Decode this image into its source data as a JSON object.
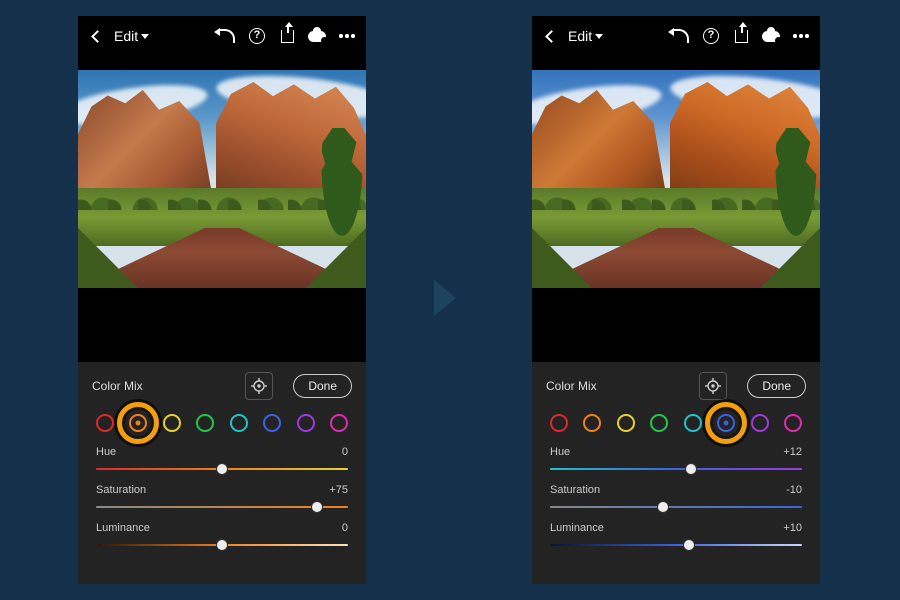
{
  "topbar": {
    "edit_label": "Edit"
  },
  "panel": {
    "title": "Color Mix",
    "done": "Done",
    "labels": {
      "hue": "Hue",
      "sat": "Saturation",
      "lum": "Luminance"
    }
  },
  "swatches": [
    {
      "name": "red",
      "color": "#e02828"
    },
    {
      "name": "orange",
      "color": "#f0801c"
    },
    {
      "name": "yellow",
      "color": "#e8d226"
    },
    {
      "name": "green",
      "color": "#20c84a"
    },
    {
      "name": "aqua",
      "color": "#1fc4c8"
    },
    {
      "name": "blue",
      "color": "#3a62e0"
    },
    {
      "name": "purple",
      "color": "#a038e0"
    },
    {
      "name": "magenta",
      "color": "#e028b0"
    }
  ],
  "screens": [
    {
      "selected_swatch": "orange",
      "hue": 0,
      "saturation": 75,
      "luminance": 0,
      "hue_display": "0",
      "sat_display": "+75",
      "lum_display": "0",
      "hue_gradient": "linear-gradient(90deg,#e02828,#f0801c,#e8d226)",
      "sat_active_color": "#f0801c",
      "lum_gradient": "linear-gradient(90deg,#2a1808,#f0801c,#ffe2c0)"
    },
    {
      "selected_swatch": "blue",
      "hue": 12,
      "saturation": -10,
      "luminance": 10,
      "hue_display": "+12",
      "sat_display": "-10",
      "lum_display": "+10",
      "hue_gradient": "linear-gradient(90deg,#1fc4c8,#3a62e0,#a038e0)",
      "sat_active_color": "#3a62e0",
      "lum_gradient": "linear-gradient(90deg,#0a1230,#3a62e0,#c8d4ff)"
    }
  ]
}
